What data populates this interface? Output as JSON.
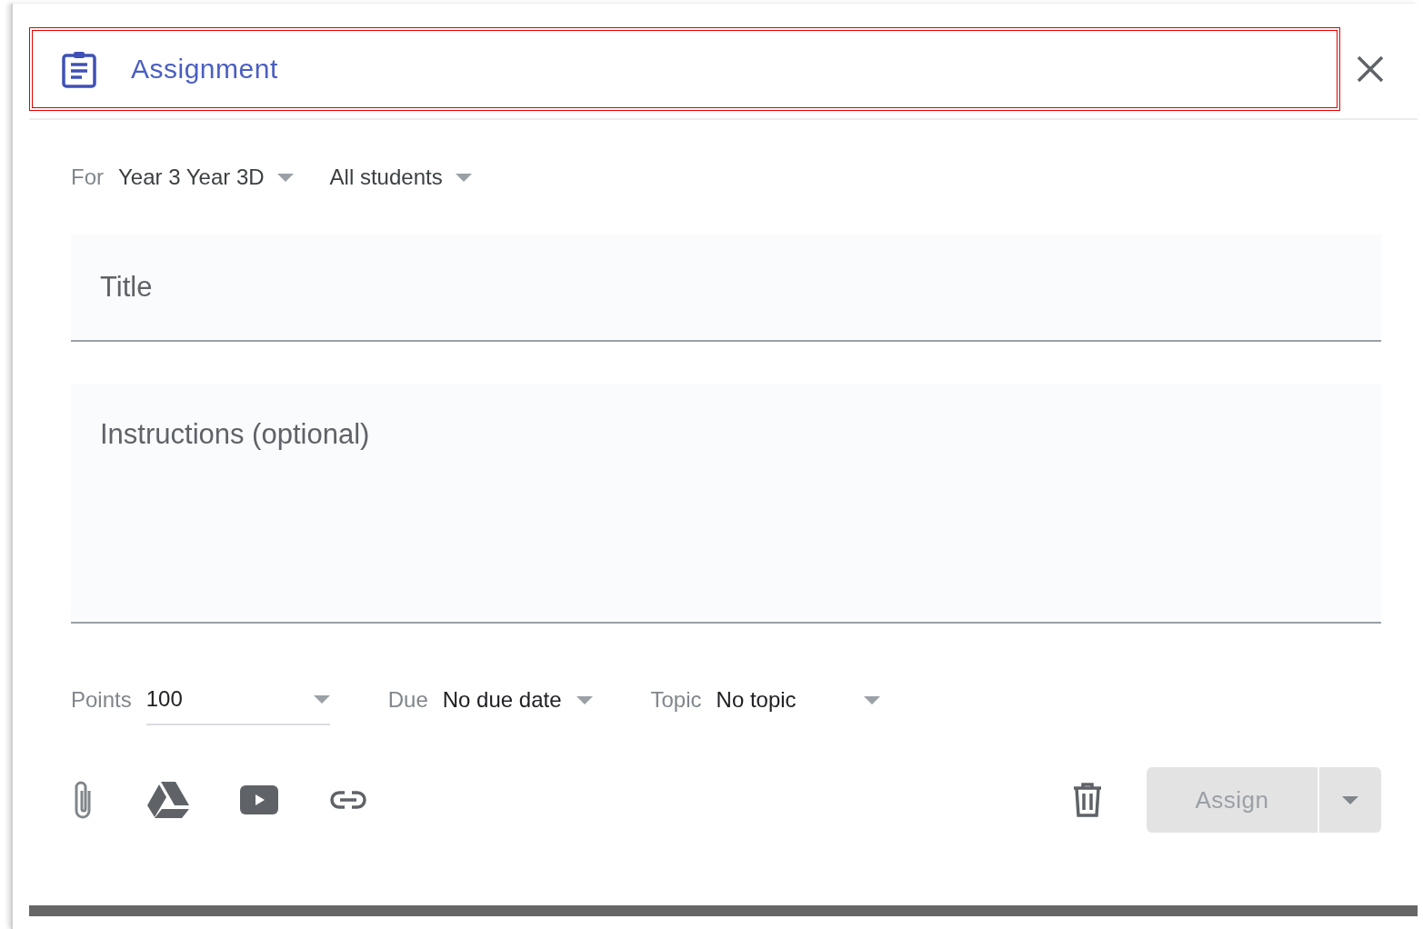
{
  "header": {
    "title": "Assignment",
    "highlighted": true
  },
  "audience": {
    "label": "For",
    "class": "Year 3 Year 3D",
    "students": "All students"
  },
  "title_field": {
    "placeholder": "Title"
  },
  "instructions_field": {
    "placeholder": "Instructions (optional)"
  },
  "details": [
    {
      "label": "Points",
      "value": "100",
      "kind": "input"
    },
    {
      "label": "Due",
      "value": "No due date",
      "kind": "select"
    },
    {
      "label": "Topic",
      "value": "No topic",
      "kind": "wide-select"
    }
  ],
  "assign_button": {
    "label": "Assign",
    "disabled": true
  }
}
